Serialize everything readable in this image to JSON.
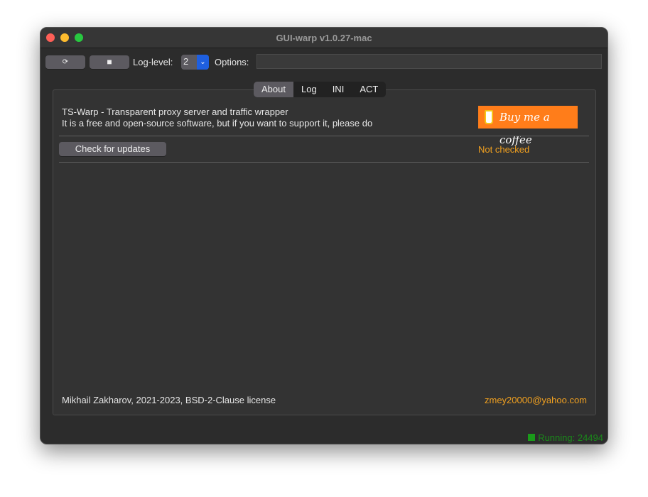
{
  "window": {
    "title": "GUI-warp v1.0.27-mac"
  },
  "toolbar": {
    "run_icon": "⟳",
    "stop_icon": "■",
    "log_level_label": "Log-level:",
    "log_level_value": "2",
    "options_label": "Options:",
    "options_value": ""
  },
  "tabs": [
    {
      "label": "About",
      "active": true
    },
    {
      "label": "Log"
    },
    {
      "label": "INI"
    },
    {
      "label": "ACT"
    }
  ],
  "about": {
    "line1": "TS-Warp - Transparent proxy server and traffic wrapper",
    "line2": "It is a free and open-source software, but if you want to support it, please do",
    "coffee_label": "Buy me a coffee",
    "check_updates": "Check for updates",
    "update_status": "Not checked",
    "copyright": "Mikhail Zakharov, 2021-2023, BSD-2-Clause license",
    "email": "zmey20000@yahoo.com"
  },
  "status": {
    "text": "Running: 24494",
    "color": "#1a9a1a"
  },
  "colors": {
    "accent": "#f0a020",
    "coffee": "#ff7d1a",
    "select": "#1e5fe0"
  }
}
